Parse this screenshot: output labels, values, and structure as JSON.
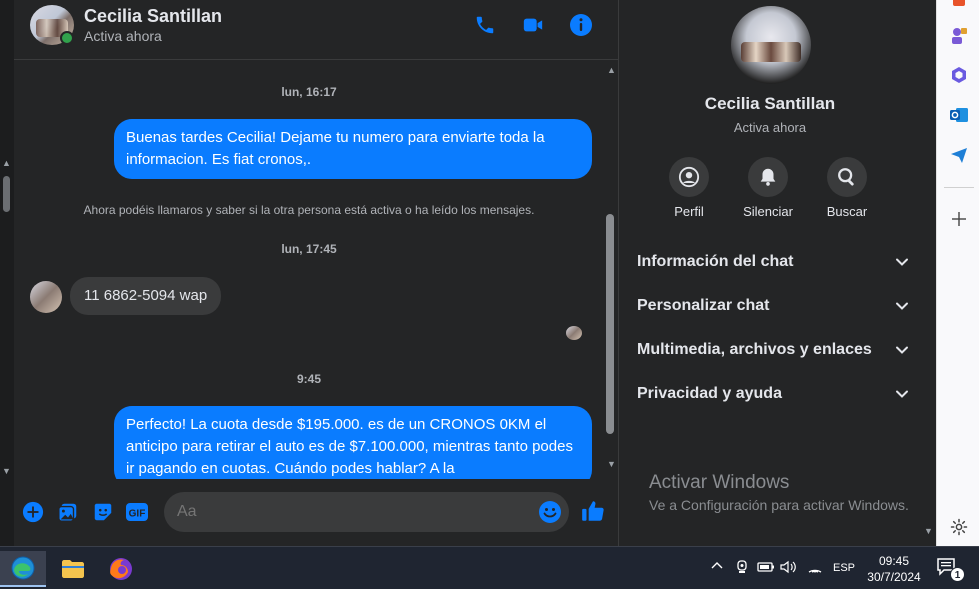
{
  "chat": {
    "contact_name": "Cecilia Santillan",
    "contact_status": "Activa ahora",
    "messages": [
      {
        "type": "timestamp",
        "text": "lun, 16:17"
      },
      {
        "type": "outgoing",
        "text": "Buenas tardes Cecilia! Dejame tu numero para enviarte toda la informacion. Es fiat cronos,."
      },
      {
        "type": "notice",
        "text": "Ahora podéis llamaros y saber si la otra persona está activa o ha leído los mensajes."
      },
      {
        "type": "timestamp",
        "text": "lun, 17:45"
      },
      {
        "type": "incoming",
        "text": "11 6862-5094 wap"
      },
      {
        "type": "timestamp",
        "text": "9:45"
      },
      {
        "type": "outgoing",
        "text": "Perfecto! La cuota desde $195.000. es de un CRONOS 0KM el anticipo para retirar el auto es de $7.100.000, mientras tanto podes ir pagando en cuotas. Cuándo podes hablar? A la"
      }
    ],
    "composer_placeholder": "Aa"
  },
  "panel": {
    "name": "Cecilia Santillan",
    "status": "Activa ahora",
    "actions": [
      {
        "label": "Perfil",
        "icon": "profile-icon"
      },
      {
        "label": "Silenciar",
        "icon": "bell-icon"
      },
      {
        "label": "Buscar",
        "icon": "search-icon"
      }
    ],
    "sections": [
      {
        "label": "Información del chat"
      },
      {
        "label": "Personalizar chat"
      },
      {
        "label": "Multimedia, archivos y enlaces"
      },
      {
        "label": "Privacidad y ayuda"
      }
    ]
  },
  "watermark": {
    "title": "Activar Windows",
    "subtitle": "Ve a Configuración para activar Windows."
  },
  "taskbar": {
    "language": "ESP",
    "time": "09:45",
    "date": "30/7/2024",
    "notifications": "1"
  },
  "colors": {
    "accent": "#0a7cff",
    "background": "#242526",
    "bubble_in": "#3a3b3c",
    "online": "#31a24c"
  }
}
